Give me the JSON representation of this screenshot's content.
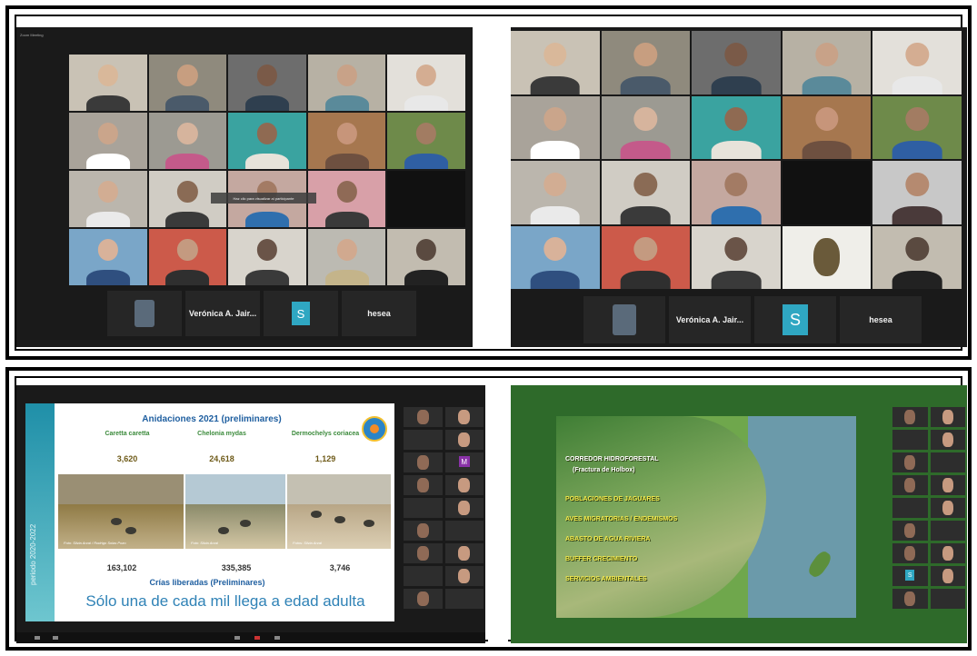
{
  "top_left_panel": {
    "window_label": "Zoom Meeting",
    "tooltip": "Haz clic para visualizar al participante"
  },
  "bottom_row": {
    "names": [
      "Verónica A. Jair...",
      "hesea"
    ],
    "avatar_letter": "S"
  },
  "slide_turtles": {
    "title": "Anidaciones 2021 (preliminares)",
    "vertical_label": "periodo 2020-2022",
    "species": [
      {
        "name": "Caretta caretta",
        "nests": "3,620"
      },
      {
        "name": "Chelonia mydas",
        "nests": "24,618"
      },
      {
        "name": "Dermochelys coriacea",
        "nests": "1,129"
      }
    ],
    "photo_credits": [
      "Foto: Silvia Arzal / Rodrigo Solas Pozo",
      "Foto: Silvia Arzal",
      "Fotos: Silvia Arzal"
    ],
    "released": [
      "163,102",
      "335,385",
      "3,746"
    ],
    "released_title": "Crías liberadas (Preliminares)",
    "motto": "Sólo una de cada mil llega a edad adulta"
  },
  "slide_map": {
    "heading": "CORREDOR HIDROFORESTAL",
    "subheading": "(Fractura de Holbox)",
    "items": [
      "POBLACIONES DE JAGUARES",
      "AVES MIGRATORIAS / ENDEMISMOS",
      "ABASTO DE AGUA  RIVIERA",
      "BUFFER CRECIMIENTO",
      "SERVICIOS AMBIENTALES"
    ]
  },
  "side_participants": {
    "letters": [
      "M",
      "S"
    ]
  }
}
